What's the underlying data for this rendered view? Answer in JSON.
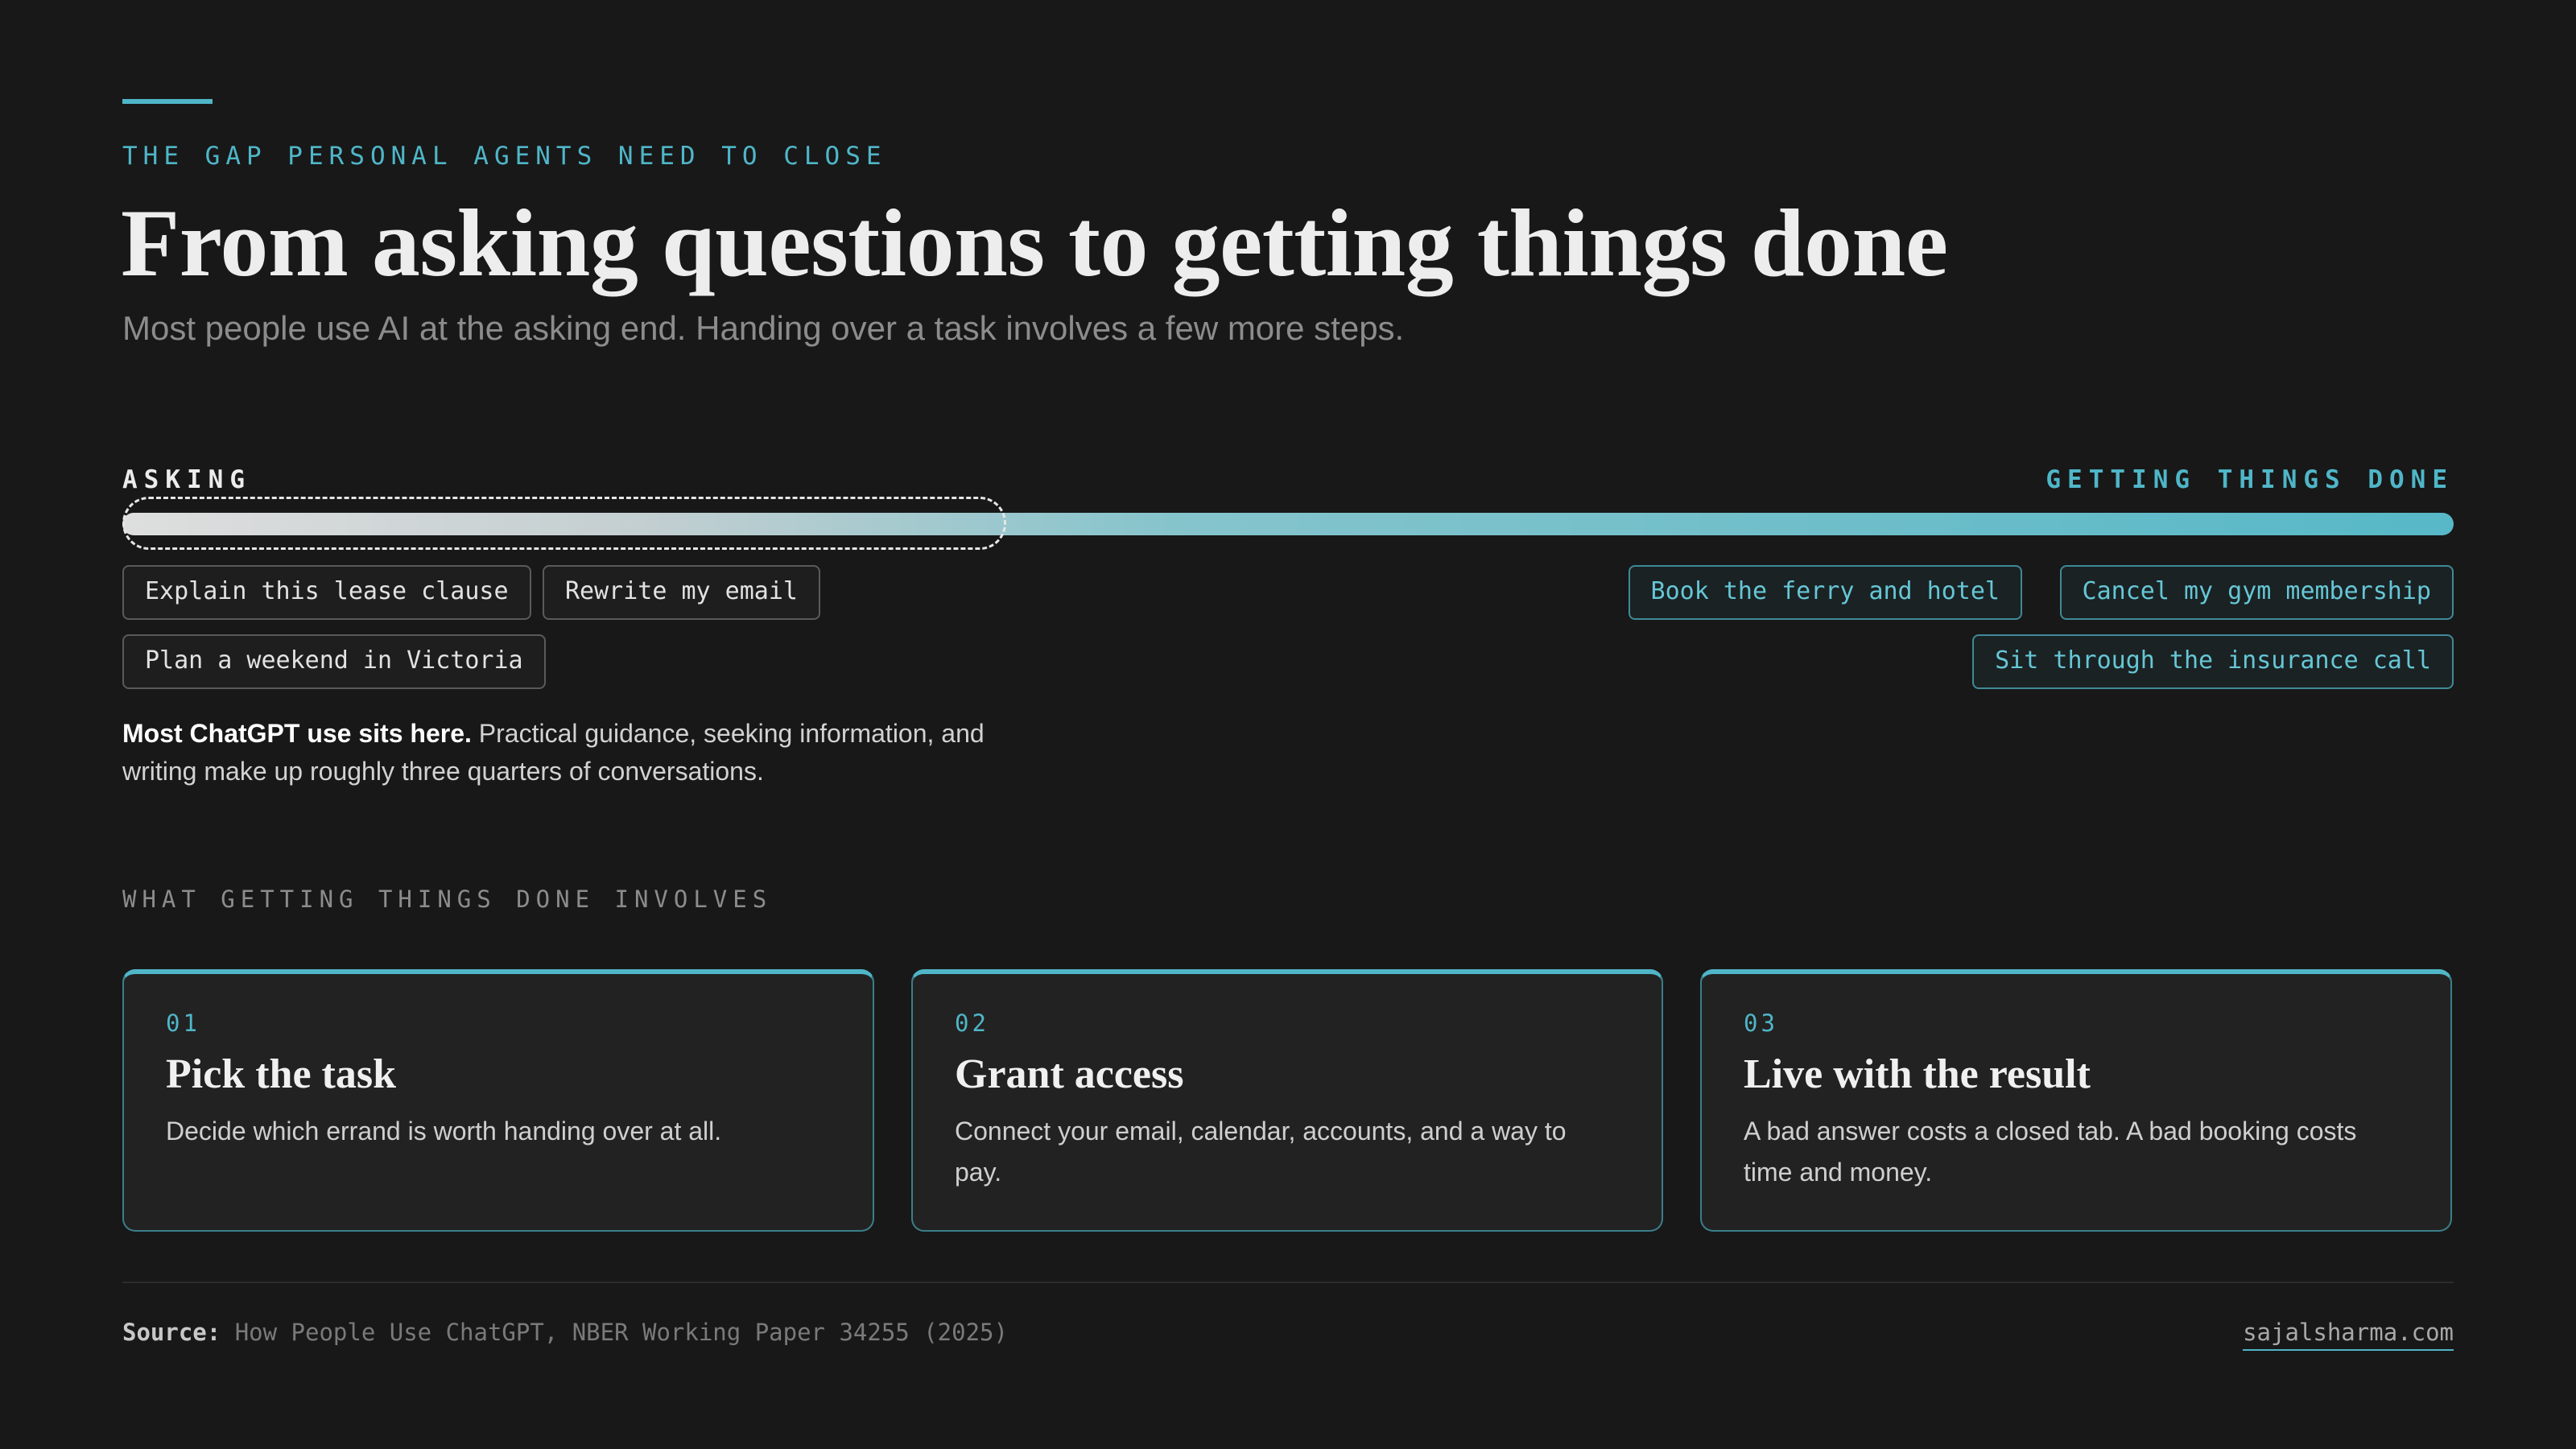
{
  "header": {
    "eyebrow": "THE GAP PERSONAL AGENTS NEED TO CLOSE",
    "title": "From asking questions to getting things done",
    "subtitle": "Most people use AI at the asking end. Handing over a task involves a few more steps."
  },
  "spectrum": {
    "left_label": "ASKING",
    "right_label": "GETTING THINGS DONE",
    "asking_examples": [
      "Explain this lease clause",
      "Rewrite my email",
      "Plan a weekend in Victoria"
    ],
    "doing_examples": [
      "Book the ferry and hotel",
      "Cancel my gym membership",
      "Sit through the insurance call"
    ],
    "note_bold": "Most ChatGPT use sits here.",
    "note_text": " Practical guidance, seeking information, and writing make up roughly three quarters of conversations."
  },
  "steps": {
    "label": "WHAT GETTING THINGS DONE INVOLVES",
    "items": [
      {
        "num": "01",
        "title": "Pick the task",
        "body": "Decide which errand is worth handing over at all."
      },
      {
        "num": "02",
        "title": "Grant access",
        "body": "Connect your email, calendar, accounts, and a way to pay."
      },
      {
        "num": "03",
        "title": "Live with the result",
        "body": "A bad answer costs a closed tab. A bad booking costs time and money."
      }
    ]
  },
  "footer": {
    "source_key": "Source:",
    "source_text": "How People Use ChatGPT, NBER Working Paper 34255 (2025)",
    "site": "sajalsharma.com"
  },
  "colors": {
    "accent": "#4fb6c8",
    "background": "#181818",
    "card": "#222222"
  }
}
